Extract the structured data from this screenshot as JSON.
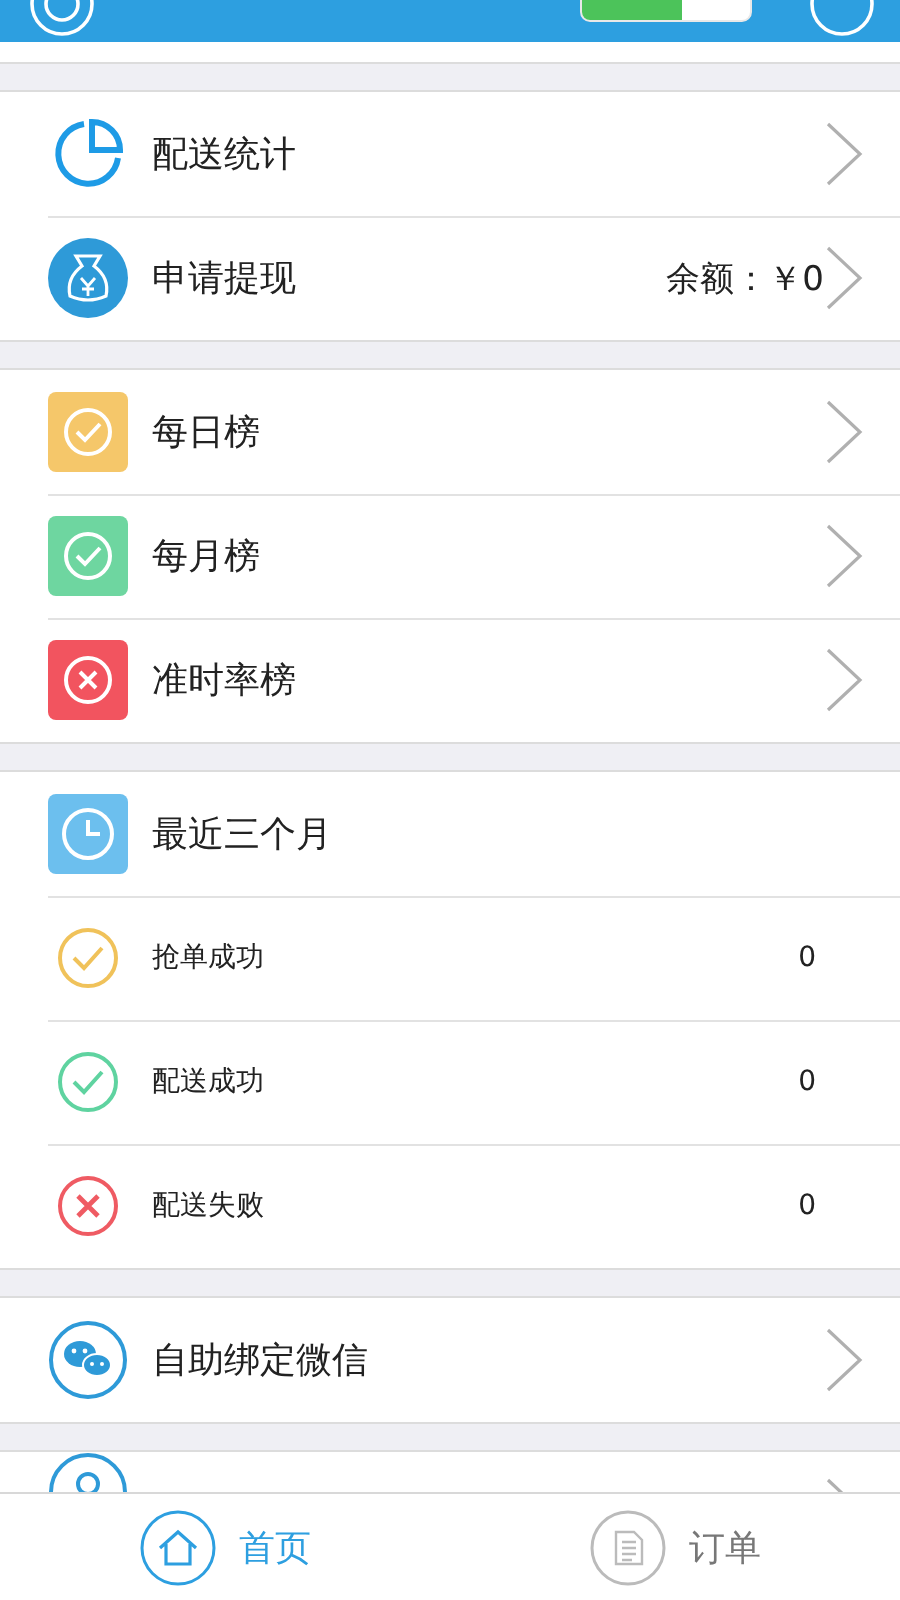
{
  "header": {
    "toggle": {
      "on": true
    }
  },
  "sections": [
    {
      "rows": [
        {
          "kind": "pie",
          "color": "#1e9be6",
          "label": "配送统计",
          "chevron": true
        },
        {
          "kind": "bag",
          "color": "#2e9ad8",
          "label": "申请提现",
          "value": "余额：￥0",
          "chevron": true
        }
      ]
    },
    {
      "rows": [
        {
          "kind": "check-tile",
          "color": "#f5c76a",
          "label": "每日榜",
          "chevron": true
        },
        {
          "kind": "check-tile",
          "color": "#6ed6a0",
          "label": "每月榜",
          "chevron": true
        },
        {
          "kind": "cross-tile",
          "color": "#f2545f",
          "label": "准时率榜",
          "chevron": true
        }
      ]
    },
    {
      "rows": [
        {
          "kind": "clock-tile",
          "color": "#6cbfee",
          "label": "最近三个月",
          "chevron": false
        },
        {
          "kind": "check-ring",
          "color": "#f0c25a",
          "label": "抢单成功",
          "count": "0",
          "chevron": false
        },
        {
          "kind": "check-ring",
          "color": "#5fd3a0",
          "label": "配送成功",
          "count": "0",
          "chevron": false
        },
        {
          "kind": "cross-ring",
          "color": "#ef5b63",
          "label": "配送失败",
          "count": "0",
          "chevron": false
        }
      ]
    },
    {
      "rows": [
        {
          "kind": "chat-ring",
          "color": "#2e9ad8",
          "label": "自助绑定微信",
          "chevron": true
        }
      ]
    },
    {
      "rows": [
        {
          "kind": "ring",
          "color": "#2e9ad8",
          "chevron": true
        }
      ]
    }
  ],
  "tabs": [
    {
      "kind": "home",
      "label": "首页",
      "selected": true
    },
    {
      "kind": "doc",
      "label": "订单",
      "selected": false
    }
  ]
}
